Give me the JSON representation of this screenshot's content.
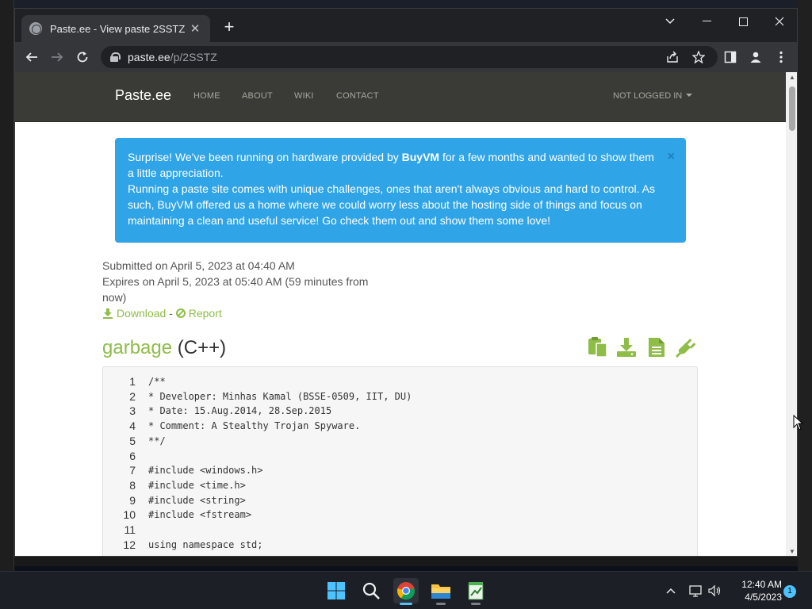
{
  "browser": {
    "tab_title": "Paste.ee - View paste 2SSTZ",
    "url_host": "paste.ee",
    "url_path": "/p/2SSTZ"
  },
  "site": {
    "brand": "Paste.ee",
    "nav": [
      "HOME",
      "ABOUT",
      "WIKI",
      "CONTACT"
    ],
    "user_menu": "NOT LOGGED IN"
  },
  "alert": {
    "line1_pre": "Surprise! We've been running on hardware provided by ",
    "line1_bold": "BuyVM",
    "line1_post": " for a few months and wanted to show them a little appreciation.",
    "line2": "Running a paste site comes with unique challenges, ones that aren't always obvious and hard to control. As such, BuyVM offered us a home where we could worry less about the hosting side of things and focus on maintaining a clean and useful service! Go check them out and show them some love!",
    "close": "×"
  },
  "meta": {
    "submitted": "Submitted on April 5, 2023 at 04:40 AM",
    "expires": "Expires on April 5, 2023 at 05:40 AM (59 minutes from now)",
    "download": "Download",
    "separator": "-",
    "report": "Report"
  },
  "paste": {
    "name": "garbage",
    "language": "(C++)",
    "lines": [
      {
        "n": "1",
        "code": "/**"
      },
      {
        "n": "2",
        "code": "* Developer: Minhas Kamal (BSSE-0509, IIT, DU)"
      },
      {
        "n": "3",
        "code": "* Date: 15.Aug.2014, 28.Sep.2015"
      },
      {
        "n": "4",
        "code": "* Comment: A Stealthy Trojan Spyware."
      },
      {
        "n": "5",
        "code": "**/"
      },
      {
        "n": "6",
        "code": ""
      },
      {
        "n": "7",
        "code": "#include <windows.h>"
      },
      {
        "n": "8",
        "code": "#include <time.h>"
      },
      {
        "n": "9",
        "code": "#include <string>"
      },
      {
        "n": "10",
        "code": "#include <fstream>"
      },
      {
        "n": "11",
        "code": ""
      },
      {
        "n": "12",
        "code": "using namespace std;"
      }
    ]
  },
  "taskbar": {
    "time": "12:40 AM",
    "date": "4/5/2023",
    "notifications": "1"
  },
  "colors": {
    "alert_bg": "#2fa4e7",
    "accent_green": "#8ebd48",
    "navbar_bg": "#3a3a36"
  }
}
